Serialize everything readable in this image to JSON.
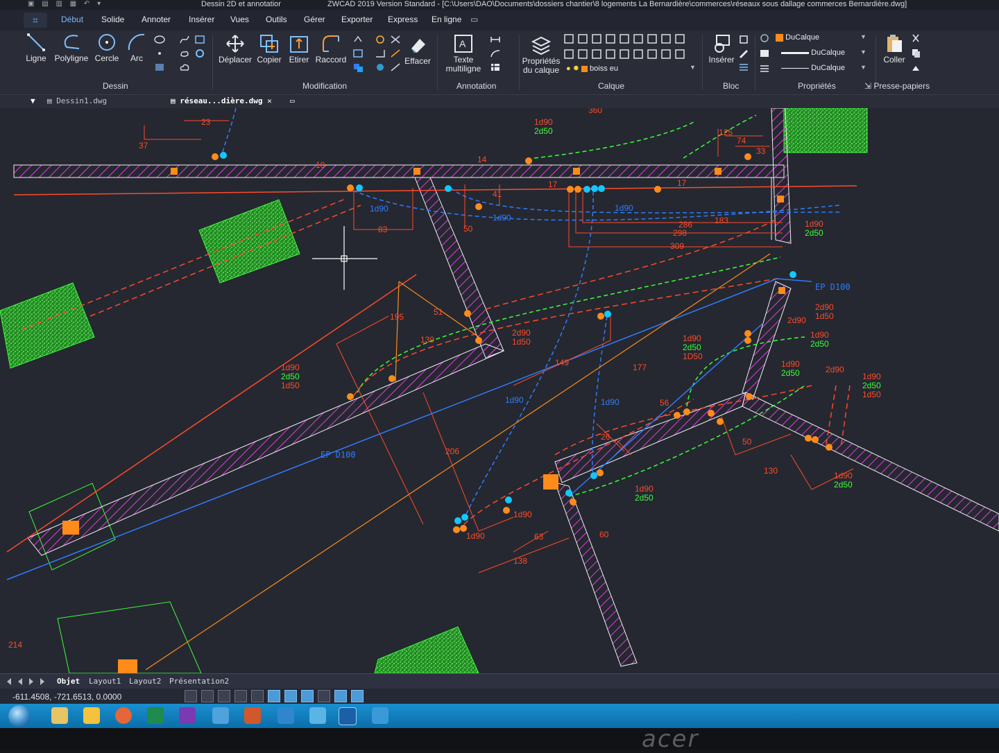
{
  "titlebar": {
    "workspace": "Dessin 2D et annotatior",
    "title": "ZWCAD 2019 Version Standard - [C:\\Users\\DAO\\Documents\\dossiers chantier\\8 logements La Bernardière\\commerces\\réseaux sous dallage commerces Bernardière.dwg]"
  },
  "menu": {
    "tabs": [
      "Début",
      "Solide",
      "Annoter",
      "Insérer",
      "Vues",
      "Outils",
      "Gérer",
      "Exporter",
      "Express",
      "En ligne"
    ],
    "active": "Début"
  },
  "ribbon": {
    "dessin": {
      "ligne": "Ligne",
      "polyligne": "Polyligne",
      "cercle": "Cercle",
      "arc": "Arc",
      "group": "Dessin"
    },
    "modification": {
      "deplacer": "Déplacer",
      "copier": "Copier",
      "etirer": "Etirer",
      "raccord": "Raccord",
      "effacer": "Effacer",
      "group": "Modification"
    },
    "annotation": {
      "texte": "Texte",
      "texte2": "multiligne",
      "group": "Annotation"
    },
    "calque": {
      "props": "Propriétés",
      "props2": "du calque",
      "layer": "boiss eu",
      "group": "Calque"
    },
    "bloc": {
      "inserer": "Insérer",
      "group": "Bloc"
    },
    "proprietes": {
      "color": "DuCalque",
      "linetype": "DuCalque",
      "lineweight": "DuCalque",
      "group": "Propriétés"
    },
    "presse": {
      "coller": "Coller",
      "group": "Presse-papiers"
    }
  },
  "doc_tabs": {
    "tab1": "Dessin1.dwg",
    "tab2": "réseau...dière.dwg"
  },
  "drawing": {
    "dims_red": [
      "360",
      "23",
      "37",
      "10",
      "14",
      "41",
      "17",
      "17",
      "83",
      "50",
      "125",
      "74",
      "33",
      "286",
      "298",
      "309",
      "183",
      "195",
      "51",
      "139",
      "149",
      "177",
      "206",
      "26",
      "56",
      "50",
      "130",
      "63",
      "60",
      "138",
      "214"
    ],
    "labels_blue": [
      "1d90",
      "1d90",
      "1d90",
      "EP D100",
      "1d90",
      "1d90",
      "EP D100"
    ],
    "labels_mixed": [
      [
        "1d90",
        "2d50"
      ],
      [
        "1d90",
        "2d50"
      ],
      [
        "2d90",
        "1d50"
      ],
      [
        "2d90",
        "1d50"
      ],
      [
        "1d90",
        "2d50"
      ],
      [
        "1d90",
        "2d50"
      ],
      [
        "1d90",
        "2d50",
        "1D50"
      ],
      [
        "1d90",
        "2d50"
      ],
      [
        "2d90"
      ],
      [
        "1d90",
        "2d50",
        "1d50"
      ],
      [
        "1d90",
        "2d50"
      ],
      [
        "1d90",
        "2d50"
      ],
      [
        "1d90",
        "2d50",
        "1d50"
      ]
    ],
    "single_red": [
      "2d90",
      "1d90",
      "1d90"
    ]
  },
  "layout_tabs": [
    "Objet",
    "Layout1",
    "Layout2",
    "Présentation2"
  ],
  "status": {
    "coords": "-611.4508, -721.6513, 0.0000"
  },
  "monitor_brand": "acer",
  "colors": {
    "red": "#ff4a2a",
    "green": "#3cff3c",
    "blue": "#2f7cff",
    "magenta": "#e040e0",
    "orange": "#ff8c1a",
    "cyan": "#12c8ff",
    "white": "#f2f2f2"
  }
}
